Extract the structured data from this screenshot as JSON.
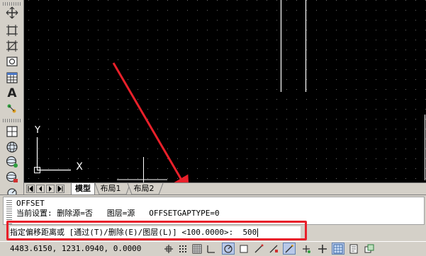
{
  "canvas": {
    "background": "#000000",
    "ucs_y_label": "Y",
    "ucs_x_label": "X"
  },
  "tabs": {
    "model": "模型",
    "layout1": "布局1",
    "layout2": "布局2"
  },
  "command": {
    "history": [
      "OFFSET",
      "当前设置: 删除源=否   图层=源   OFFSETGAPTYPE=0"
    ],
    "prompt": "指定偏移距离或 [通过(T)/删除(E)/图层(L)] <100.0000>:  ",
    "value": "500"
  },
  "status": {
    "coordinates": "4483.6150, 1231.0940, 0.0000"
  },
  "annotation": {
    "color": "#e8202a"
  },
  "left_toolbar": {
    "icons": [
      "move-icon",
      "scale-icon",
      "stretch-icon",
      "region-icon",
      "table-icon",
      "text-icon",
      "add-selected-icon",
      "new-viewport-icon",
      "orbit-icon",
      "zoom-icon",
      "lock-icon",
      "measure-icon"
    ]
  },
  "status_toggles": [
    "snap",
    "grid",
    "ortho",
    "polar",
    "osnap",
    "otrack",
    "ducs",
    "dyn",
    "lwt",
    "qp",
    "model",
    "layout",
    "maximize"
  ]
}
